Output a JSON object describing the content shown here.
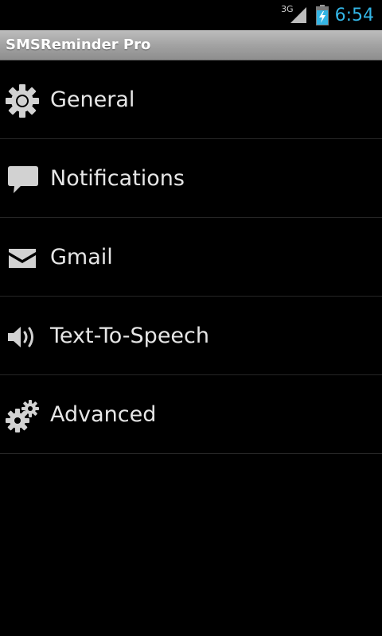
{
  "status_bar": {
    "network_type": "3G",
    "time": "6:54",
    "icons": [
      "signal-icon",
      "battery-charging-icon"
    ]
  },
  "app": {
    "title": "SMSReminder Pro"
  },
  "menu": {
    "items": [
      {
        "label": "General",
        "icon": "gear-icon"
      },
      {
        "label": "Notifications",
        "icon": "speech-bubble-icon"
      },
      {
        "label": "Gmail",
        "icon": "mail-icon"
      },
      {
        "label": "Text-To-Speech",
        "icon": "speaker-icon"
      },
      {
        "label": "Advanced",
        "icon": "gears-icon"
      }
    ]
  },
  "colors": {
    "background": "#000000",
    "clock": "#33b5e5",
    "label": "#e6e6e6",
    "title_bar": "#a3a3a3",
    "divider": "#262626"
  }
}
